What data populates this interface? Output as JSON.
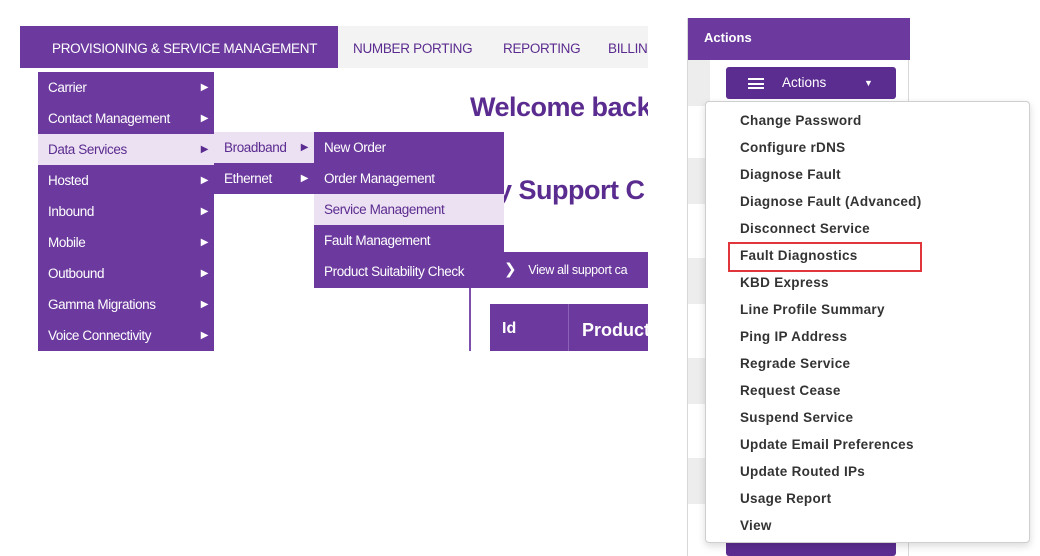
{
  "topnav": {
    "tabs": [
      {
        "label": "PROVISIONING & SERVICE MANAGEMENT",
        "active": true
      },
      {
        "label": "NUMBER PORTING"
      },
      {
        "label": "REPORTING"
      },
      {
        "label": "BILLIN"
      }
    ]
  },
  "main": {
    "welcome": "Welcome back",
    "support_heading": "ly Support C",
    "view_all": "View all support ca",
    "table_headers": [
      "Id",
      "Product"
    ]
  },
  "menus": {
    "level1": [
      {
        "label": "Carrier"
      },
      {
        "label": "Contact Management"
      },
      {
        "label": "Data Services",
        "highlighted": true
      },
      {
        "label": "Hosted"
      },
      {
        "label": "Inbound"
      },
      {
        "label": "Mobile"
      },
      {
        "label": "Outbound"
      },
      {
        "label": "Gamma Migrations"
      },
      {
        "label": "Voice Connectivity"
      }
    ],
    "level2": [
      {
        "label": "Broadband",
        "highlighted": true
      },
      {
        "label": "Ethernet"
      }
    ],
    "level3": [
      {
        "label": "New Order"
      },
      {
        "label": "Order Management"
      },
      {
        "label": "Service Management",
        "highlighted": true
      },
      {
        "label": "Fault Management"
      },
      {
        "label": "Product Suitability Check"
      }
    ]
  },
  "actions": {
    "header": "Actions",
    "button_label": "Actions",
    "options": [
      "Change Password",
      "Configure rDNS",
      "Diagnose Fault",
      "Diagnose Fault (Advanced)",
      "Disconnect Service",
      "Fault Diagnostics",
      "KBD Express",
      "Line Profile Summary",
      "Ping IP Address",
      "Regrade Service",
      "Request Cease",
      "Suspend Service",
      "Update Email Preferences",
      "Update Routed IPs",
      "Usage Report",
      "View"
    ],
    "highlighted_option": "Fault Diagnostics"
  },
  "icons": {
    "caret": "▶",
    "dropdown_caret": "▼",
    "arrow": "❯"
  },
  "colors": {
    "brand_purple": "#6c3a9e",
    "highlight_lavender": "#ece0f3",
    "annotation_red": "#e0353a"
  }
}
